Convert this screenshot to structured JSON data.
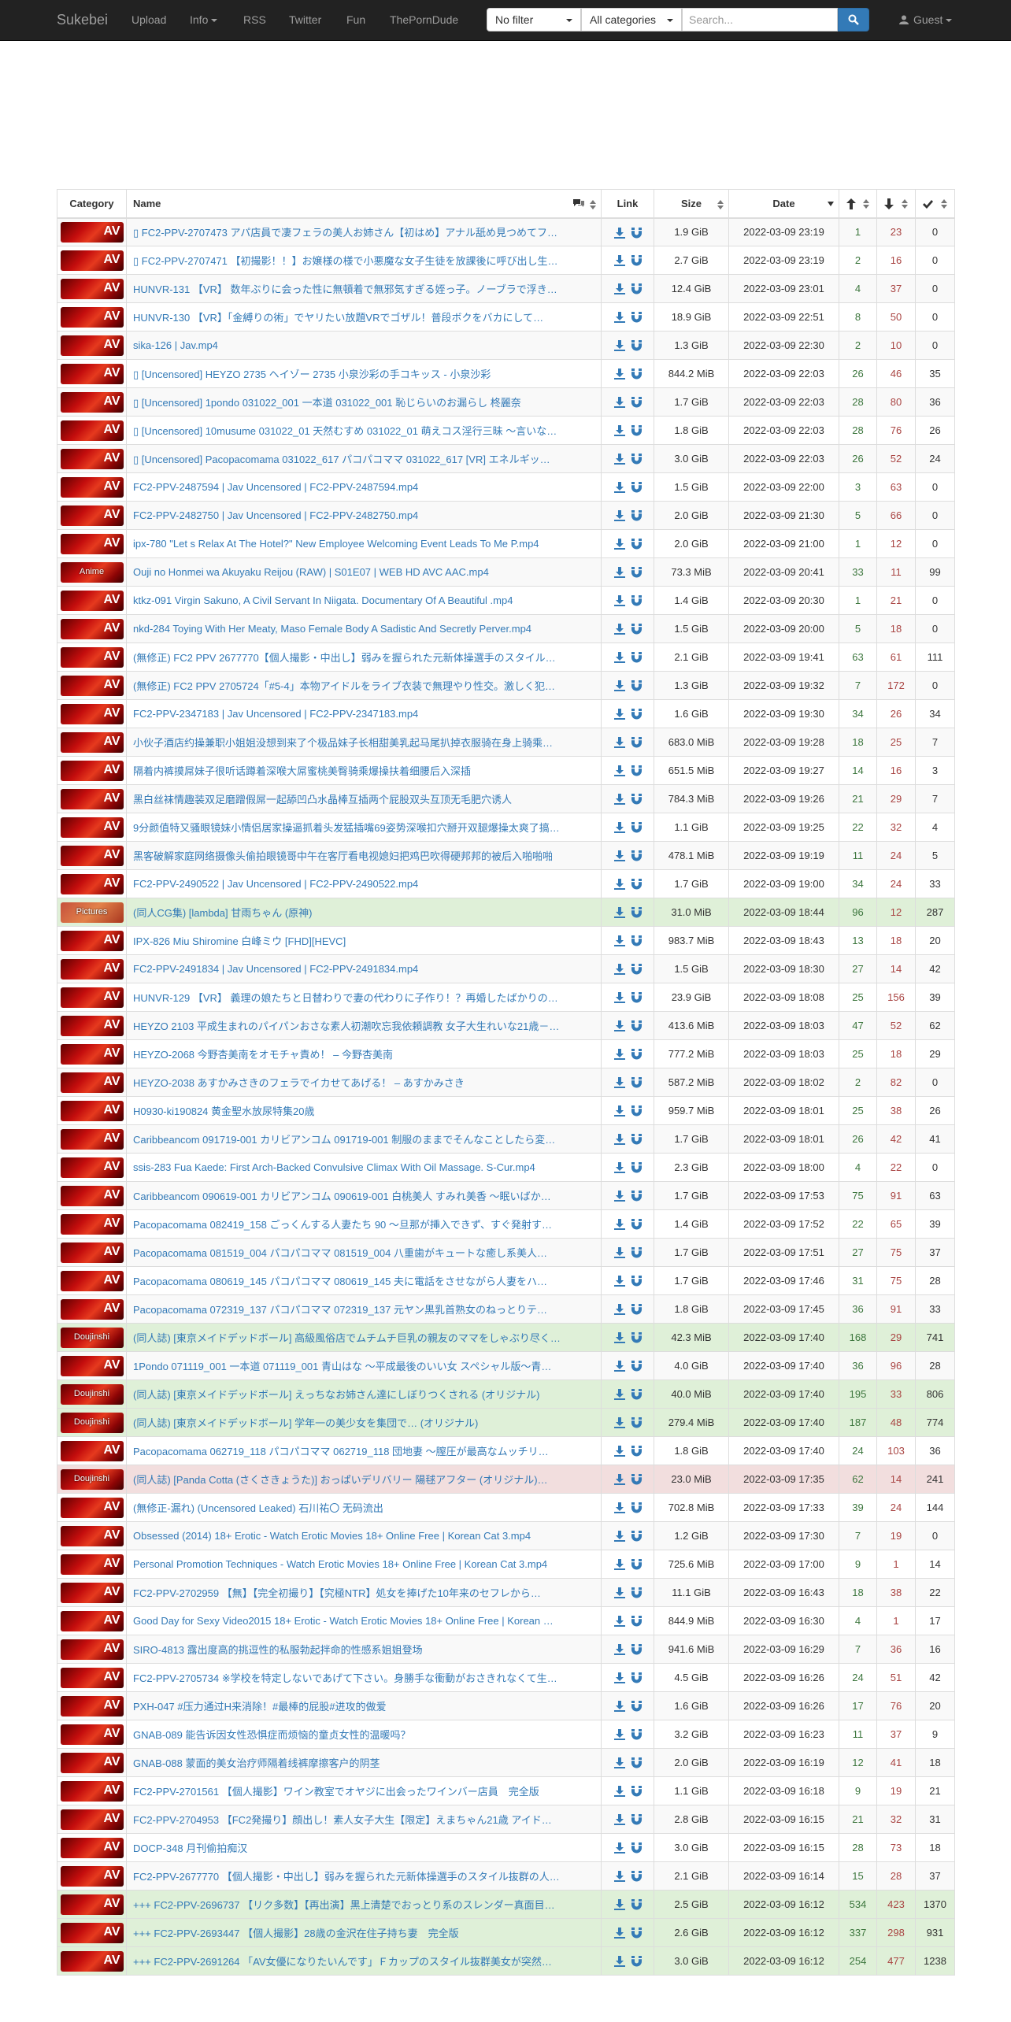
{
  "navbar": {
    "brand": "Sukebei",
    "links": [
      "Upload",
      "Info",
      "RSS",
      "Twitter",
      "Fun",
      "ThePornDude"
    ],
    "filter_select": "No filter",
    "category_select": "All categories",
    "search_placeholder": "Search...",
    "user_menu": "Guest"
  },
  "colors": {
    "navbar_bg": "#222222",
    "link": "#337ab7",
    "seeders": "#3c763d",
    "leechers": "#a94442",
    "trusted_row": "#dff0d8",
    "remake_row": "#f2dede"
  },
  "table": {
    "headers": {
      "category": "Category",
      "name": "Name",
      "link": "Link",
      "size": "Size",
      "date": "Date"
    },
    "rows": [
      {
        "cat": "AV",
        "name": "▯ FC2-PPV-2707473 アパ店員で凄フェラの美人お姉さん【初はめ】アナル舐め見つめてフ…",
        "size": "1.9 GiB",
        "date": "2022-03-09 23:19",
        "s": "1",
        "l": "23",
        "d": "0",
        "style": ""
      },
      {
        "cat": "AV",
        "name": "▯ FC2-PPV-2707471 【初撮影！！】お嬢様の様で小悪魔な女子生徒を放課後に呼び出し生…",
        "size": "2.7 GiB",
        "date": "2022-03-09 23:19",
        "s": "2",
        "l": "16",
        "d": "0",
        "style": ""
      },
      {
        "cat": "AV",
        "name": "HUNVR-131 【VR】 数年ぶりに会った性に無頓着で無邪気すぎる姪っ子。ノーブラで浮き…",
        "size": "12.4 GiB",
        "date": "2022-03-09 23:01",
        "s": "4",
        "l": "37",
        "d": "0",
        "style": ""
      },
      {
        "cat": "AV",
        "name": "HUNVR-130 【VR】「金縛りの術」でヤリたい放題VRでゴザル！普段ボクをバカにして…",
        "size": "18.9 GiB",
        "date": "2022-03-09 22:51",
        "s": "8",
        "l": "50",
        "d": "0",
        "style": ""
      },
      {
        "cat": "AV",
        "name": "sika-126 | Jav.mp4",
        "size": "1.3 GiB",
        "date": "2022-03-09 22:30",
        "s": "2",
        "l": "10",
        "d": "0",
        "style": ""
      },
      {
        "cat": "AV",
        "name": "▯ [Uncensored] HEYZO 2735 ヘイゾー 2735 小泉沙彩の手コキッス - 小泉沙彩",
        "size": "844.2 MiB",
        "date": "2022-03-09 22:03",
        "s": "26",
        "l": "46",
        "d": "35",
        "style": ""
      },
      {
        "cat": "AV",
        "name": "▯ [Uncensored] 1pondo 031022_001 一本道 031022_001 恥じらいのお漏らし 柊麗奈",
        "size": "1.7 GiB",
        "date": "2022-03-09 22:03",
        "s": "28",
        "l": "80",
        "d": "36",
        "style": ""
      },
      {
        "cat": "AV",
        "name": "▯ [Uncensored] 10musume 031022_01 天然むすめ 031022_01 萌えコス淫行三昧 ～言いな…",
        "size": "1.8 GiB",
        "date": "2022-03-09 22:03",
        "s": "28",
        "l": "76",
        "d": "26",
        "style": ""
      },
      {
        "cat": "AV",
        "name": "▯ [Uncensored] Pacopacomama 031022_617 パコパコママ 031022_617 [VR] エネルギッ…",
        "size": "3.0 GiB",
        "date": "2022-03-09 22:03",
        "s": "26",
        "l": "52",
        "d": "24",
        "style": ""
      },
      {
        "cat": "AV",
        "name": "FC2-PPV-2487594 | Jav Uncensored | FC2-PPV-2487594.mp4",
        "size": "1.5 GiB",
        "date": "2022-03-09 22:00",
        "s": "3",
        "l": "63",
        "d": "0",
        "style": ""
      },
      {
        "cat": "AV",
        "name": "FC2-PPV-2482750 | Jav Uncensored | FC2-PPV-2482750.mp4",
        "size": "2.0 GiB",
        "date": "2022-03-09 21:30",
        "s": "5",
        "l": "66",
        "d": "0",
        "style": ""
      },
      {
        "cat": "AV",
        "name": "ipx-780 \"Let s Relax At The Hotel?\" New Employee Welcoming Event Leads To Me P.mp4",
        "size": "2.0 GiB",
        "date": "2022-03-09 21:00",
        "s": "1",
        "l": "12",
        "d": "0",
        "style": ""
      },
      {
        "cat": "Anime",
        "name": "Ouji no Honmei wa Akuyaku Reijou (RAW) | S01E07 | WEB HD AVC AAC.mp4",
        "size": "73.3 MiB",
        "date": "2022-03-09 20:41",
        "s": "33",
        "l": "11",
        "d": "99",
        "style": ""
      },
      {
        "cat": "AV",
        "name": "ktkz-091 Virgin Sakuno, A Civil Servant In Niigata. Documentary Of A Beautiful .mp4",
        "size": "1.4 GiB",
        "date": "2022-03-09 20:30",
        "s": "1",
        "l": "21",
        "d": "0",
        "style": ""
      },
      {
        "cat": "AV",
        "name": "nkd-284 Toying With Her Meaty, Maso Female Body A Sadistic And Secretly Perver.mp4",
        "size": "1.5 GiB",
        "date": "2022-03-09 20:00",
        "s": "5",
        "l": "18",
        "d": "0",
        "style": ""
      },
      {
        "cat": "AV",
        "name": "(無修正) FC2 PPV 2677770【個人撮影・中出し】弱みを握られた元新体操選手のスタイル…",
        "size": "2.1 GiB",
        "date": "2022-03-09 19:41",
        "s": "63",
        "l": "61",
        "d": "111",
        "style": ""
      },
      {
        "cat": "AV",
        "name": "(無修正) FC2 PPV 2705724「#5-4」本物アイドルをライブ衣装で無理やり性交。激しく犯…",
        "size": "1.3 GiB",
        "date": "2022-03-09 19:32",
        "s": "7",
        "l": "172",
        "d": "0",
        "style": ""
      },
      {
        "cat": "AV",
        "name": "FC2-PPV-2347183 | Jav Uncensored | FC2-PPV-2347183.mp4",
        "size": "1.6 GiB",
        "date": "2022-03-09 19:30",
        "s": "34",
        "l": "26",
        "d": "34",
        "style": ""
      },
      {
        "cat": "AV",
        "name": "小伙子酒店约操兼职小姐姐没想到来了个极品妹子长相甜美乳起马尾扒掉衣服骑在身上骑乘…",
        "size": "683.0 MiB",
        "date": "2022-03-09 19:28",
        "s": "18",
        "l": "25",
        "d": "7",
        "style": ""
      },
      {
        "cat": "AV",
        "name": "隔着内裤摸屌妹子很听话蹲着深喉大屌蜜桃美臀骑乘爆操扶着细腰后入深插",
        "size": "651.5 MiB",
        "date": "2022-03-09 19:27",
        "s": "14",
        "l": "16",
        "d": "3",
        "style": ""
      },
      {
        "cat": "AV",
        "name": "黑白丝袜情趣装双足磨蹭假屌一起舔凹凸水晶棒互插两个屁股双头互顶无毛肥穴诱人",
        "size": "784.3 MiB",
        "date": "2022-03-09 19:26",
        "s": "21",
        "l": "29",
        "d": "7",
        "style": ""
      },
      {
        "cat": "AV",
        "name": "9分颜值特又骚眼镜妹小情侣居家操逼抓着头发猛插嘴69姿势深喉扣穴掰开双腿爆操太爽了搞…",
        "size": "1.1 GiB",
        "date": "2022-03-09 19:25",
        "s": "22",
        "l": "32",
        "d": "4",
        "style": ""
      },
      {
        "cat": "AV",
        "name": "黑客破解家庭网络摄像头偷拍眼镜哥中午在客厅看电视媳妇把鸡巴吹得硬邦邦的被后入啪啪啪",
        "size": "478.1 MiB",
        "date": "2022-03-09 19:19",
        "s": "11",
        "l": "24",
        "d": "5",
        "style": ""
      },
      {
        "cat": "AV",
        "name": "FC2-PPV-2490522 | Jav Uncensored | FC2-PPV-2490522.mp4",
        "size": "1.7 GiB",
        "date": "2022-03-09 19:00",
        "s": "34",
        "l": "24",
        "d": "33",
        "style": ""
      },
      {
        "cat": "Pictures",
        "name": "(同人CG集) [lambda] 甘雨ちゃん (原神)",
        "size": "31.0 MiB",
        "date": "2022-03-09 18:44",
        "s": "96",
        "l": "12",
        "d": "287",
        "style": "success"
      },
      {
        "cat": "AV",
        "name": "IPX-826 Miu Shiromine 白峰ミウ [FHD][HEVC]",
        "size": "983.7 MiB",
        "date": "2022-03-09 18:43",
        "s": "13",
        "l": "18",
        "d": "20",
        "style": ""
      },
      {
        "cat": "AV",
        "name": "FC2-PPV-2491834 | Jav Uncensored | FC2-PPV-2491834.mp4",
        "size": "1.5 GiB",
        "date": "2022-03-09 18:30",
        "s": "27",
        "l": "14",
        "d": "42",
        "style": ""
      },
      {
        "cat": "AV",
        "name": "HUNVR-129 【VR】 義理の娘たちと日替わりで妻の代わりに子作り！？再婚したばかりの…",
        "size": "23.9 GiB",
        "date": "2022-03-09 18:08",
        "s": "25",
        "l": "156",
        "d": "39",
        "style": ""
      },
      {
        "cat": "AV",
        "name": "HEYZO 2103 平成生まれのパイパンおさな素人初潮吹忘我依頼調教 女子大生れいな21歳－…",
        "size": "413.6 MiB",
        "date": "2022-03-09 18:03",
        "s": "47",
        "l": "52",
        "d": "62",
        "style": ""
      },
      {
        "cat": "AV",
        "name": "HEYZO-2068 今野杏美南をオモチャ責め！ – 今野杏美南",
        "size": "777.2 MiB",
        "date": "2022-03-09 18:03",
        "s": "25",
        "l": "18",
        "d": "29",
        "style": ""
      },
      {
        "cat": "AV",
        "name": "HEYZO-2038 あすかみさきのフェラでイカせてあげる！ – あすかみさき",
        "size": "587.2 MiB",
        "date": "2022-03-09 18:02",
        "s": "2",
        "l": "82",
        "d": "0",
        "style": ""
      },
      {
        "cat": "AV",
        "name": "H0930-ki190824 黄金聖水放尿特集20歳",
        "size": "959.7 MiB",
        "date": "2022-03-09 18:01",
        "s": "25",
        "l": "38",
        "d": "26",
        "style": ""
      },
      {
        "cat": "AV",
        "name": "Caribbeancom 091719-001 カリビアンコム 091719-001 制服のままでそんなことしたら変…",
        "size": "1.7 GiB",
        "date": "2022-03-09 18:01",
        "s": "26",
        "l": "42",
        "d": "41",
        "style": ""
      },
      {
        "cat": "AV",
        "name": "ssis-283 Fua Kaede: First Arch-Backed Convulsive Climax With Oil Massage. S-Cur.mp4",
        "size": "2.3 GiB",
        "date": "2022-03-09 18:00",
        "s": "4",
        "l": "22",
        "d": "0",
        "style": ""
      },
      {
        "cat": "AV",
        "name": "Caribbeancom 090619-001 カリビアンコム 090619-001 白桃美人 すみれ美香 ～眠いばか…",
        "size": "1.7 GiB",
        "date": "2022-03-09 17:53",
        "s": "75",
        "l": "91",
        "d": "63",
        "style": ""
      },
      {
        "cat": "AV",
        "name": "Pacopacomama 082419_158 ごっくんする人妻たち 90 ～旦那が挿入できず、すぐ発射す…",
        "size": "1.4 GiB",
        "date": "2022-03-09 17:52",
        "s": "22",
        "l": "65",
        "d": "39",
        "style": ""
      },
      {
        "cat": "AV",
        "name": "Pacopacomama 081519_004 パコパコママ 081519_004 八重歯がキュートな癒し系美人…",
        "size": "1.7 GiB",
        "date": "2022-03-09 17:51",
        "s": "27",
        "l": "75",
        "d": "37",
        "style": ""
      },
      {
        "cat": "AV",
        "name": "Pacopacomama 080619_145 パコパコママ 080619_145 夫に電話をさせながら人妻をハ…",
        "size": "1.7 GiB",
        "date": "2022-03-09 17:46",
        "s": "31",
        "l": "75",
        "d": "28",
        "style": ""
      },
      {
        "cat": "AV",
        "name": "Pacopacomama 072319_137 パコパコママ 072319_137 元ヤン黒乳首熟女のねっとりテ…",
        "size": "1.8 GiB",
        "date": "2022-03-09 17:45",
        "s": "36",
        "l": "91",
        "d": "33",
        "style": ""
      },
      {
        "cat": "Doujinshi",
        "name": "(同人誌) [東京メイドデッドボール] 高級風俗店でムチムチ巨乳の親友のママをしゃぶり尽く…",
        "size": "42.3 MiB",
        "date": "2022-03-09 17:40",
        "s": "168",
        "l": "29",
        "d": "741",
        "style": "success"
      },
      {
        "cat": "AV",
        "name": "1Pondo 071119_001 一本道 071119_001 青山はな ～平成最後のいい女 スペシャル版～青…",
        "size": "4.0 GiB",
        "date": "2022-03-09 17:40",
        "s": "36",
        "l": "96",
        "d": "28",
        "style": ""
      },
      {
        "cat": "Doujinshi",
        "name": "(同人誌) [東京メイドデッドボール] えっちなお姉さん達にしぼりつくされる (オリジナル)",
        "size": "40.0 MiB",
        "date": "2022-03-09 17:40",
        "s": "195",
        "l": "33",
        "d": "806",
        "style": "success"
      },
      {
        "cat": "Doujinshi",
        "name": "(同人誌) [東京メイドデッドボール] 学年一の美少女を集団で… (オリジナル)",
        "size": "279.4 MiB",
        "date": "2022-03-09 17:40",
        "s": "187",
        "l": "48",
        "d": "774",
        "style": "success"
      },
      {
        "cat": "AV",
        "name": "Pacopacomama 062719_118 パコパコママ 062719_118 団地妻 ～膣圧が最高なムッチリ…",
        "size": "1.8 GiB",
        "date": "2022-03-09 17:40",
        "s": "24",
        "l": "103",
        "d": "36",
        "style": ""
      },
      {
        "cat": "Doujinshi",
        "name": "(同人誌) [Panda Cotta (さくさきょうた)] おっぱいデリバリー 陽毬アフター (オリジナル)…",
        "size": "23.0 MiB",
        "date": "2022-03-09 17:35",
        "s": "62",
        "l": "14",
        "d": "241",
        "style": "danger"
      },
      {
        "cat": "AV",
        "name": "(無修正-漏れ) (Uncensored Leaked) 石川祐〇 无码流出",
        "size": "702.8 MiB",
        "date": "2022-03-09 17:33",
        "s": "39",
        "l": "24",
        "d": "144",
        "style": ""
      },
      {
        "cat": "AV",
        "name": "Obsessed (2014) 18+ Erotic - Watch Erotic Movies 18+ Online Free | Korean Cat 3.mp4",
        "size": "1.2 GiB",
        "date": "2022-03-09 17:30",
        "s": "7",
        "l": "19",
        "d": "0",
        "style": ""
      },
      {
        "cat": "AV",
        "name": "Personal Promotion Techniques - Watch Erotic Movies 18+ Online Free | Korean Cat 3.mp4",
        "size": "725.6 MiB",
        "date": "2022-03-09 17:00",
        "s": "9",
        "l": "1",
        "d": "14",
        "style": ""
      },
      {
        "cat": "AV",
        "name": "FC2-PPV-2702959 【無】【完全初撮り】【究極NTR】処女を捧げた10年来のセフレから…",
        "size": "11.1 GiB",
        "date": "2022-03-09 16:43",
        "s": "18",
        "l": "38",
        "d": "22",
        "style": ""
      },
      {
        "cat": "AV",
        "name": "Good Day for Sexy Video2015 18+ Erotic - Watch Erotic Movies 18+ Online Free | Korean …",
        "size": "844.9 MiB",
        "date": "2022-03-09 16:30",
        "s": "4",
        "l": "1",
        "d": "17",
        "style": ""
      },
      {
        "cat": "AV",
        "name": "SIRO-4813 露出度高的挑逗性的私服勃起拌命的性感系姐姐登场",
        "size": "941.6 MiB",
        "date": "2022-03-09 16:29",
        "s": "7",
        "l": "36",
        "d": "16",
        "style": ""
      },
      {
        "cat": "AV",
        "name": "FC2-PPV-2705734 ※学校を特定しないであげて下さい。身勝手な衝動がおさきれなくて生…",
        "size": "4.5 GiB",
        "date": "2022-03-09 16:26",
        "s": "24",
        "l": "51",
        "d": "42",
        "style": ""
      },
      {
        "cat": "AV",
        "name": "PXH-047 #压力通过H来消除！#最棒的屁股#进攻的做爱",
        "size": "1.6 GiB",
        "date": "2022-03-09 16:26",
        "s": "17",
        "l": "76",
        "d": "20",
        "style": ""
      },
      {
        "cat": "AV",
        "name": "GNAB-089 能告诉因女性恐惧症而烦恼的童贞女性的温暖吗？",
        "size": "3.2 GiB",
        "date": "2022-03-09 16:23",
        "s": "11",
        "l": "37",
        "d": "9",
        "style": ""
      },
      {
        "cat": "AV",
        "name": "GNAB-088 蒙面的美女治疗师隔着线裤摩擦客户的阴茎",
        "size": "2.0 GiB",
        "date": "2022-03-09 16:19",
        "s": "12",
        "l": "41",
        "d": "18",
        "style": ""
      },
      {
        "cat": "AV",
        "name": "FC2-PPV-2701561 【個人撮影】ワイン教室でオヤジに出会ったワインバー店員　完全版",
        "size": "1.1 GiB",
        "date": "2022-03-09 16:18",
        "s": "9",
        "l": "19",
        "d": "21",
        "style": ""
      },
      {
        "cat": "AV",
        "name": "FC2-PPV-2704953 【FC2発撮り】顔出し！素人女子大生【限定】えまちゃん21歳 アイド…",
        "size": "2.8 GiB",
        "date": "2022-03-09 16:15",
        "s": "21",
        "l": "32",
        "d": "31",
        "style": ""
      },
      {
        "cat": "AV",
        "name": "DOCP-348 月刊偷拍痴汉",
        "size": "3.0 GiB",
        "date": "2022-03-09 16:15",
        "s": "28",
        "l": "73",
        "d": "18",
        "style": ""
      },
      {
        "cat": "AV",
        "name": "FC2-PPV-2677770 【個人撮影・中出し】弱みを握られた元新体操選手のスタイル抜群の人…",
        "size": "2.1 GiB",
        "date": "2022-03-09 16:14",
        "s": "15",
        "l": "28",
        "d": "37",
        "style": ""
      },
      {
        "cat": "AV",
        "name": "+++ FC2-PPV-2696737 【リク多数】【再出演】黒上清楚でおっとり系のスレンダー真面目…",
        "size": "2.5 GiB",
        "date": "2022-03-09 16:12",
        "s": "534",
        "l": "423",
        "d": "1370",
        "style": "success"
      },
      {
        "cat": "AV",
        "name": "+++ FC2-PPV-2693447 【個人撮影】28歳の金沢在住子持ち妻　完全版",
        "size": "2.6 GiB",
        "date": "2022-03-09 16:12",
        "s": "337",
        "l": "298",
        "d": "931",
        "style": "success"
      },
      {
        "cat": "AV",
        "name": "+++ FC2-PPV-2691264 「AV女優になりたいんです」Ｆカップのスタイル抜群美女が突然…",
        "size": "3.0 GiB",
        "date": "2022-03-09 16:12",
        "s": "254",
        "l": "477",
        "d": "1238",
        "style": "success"
      }
    ]
  }
}
